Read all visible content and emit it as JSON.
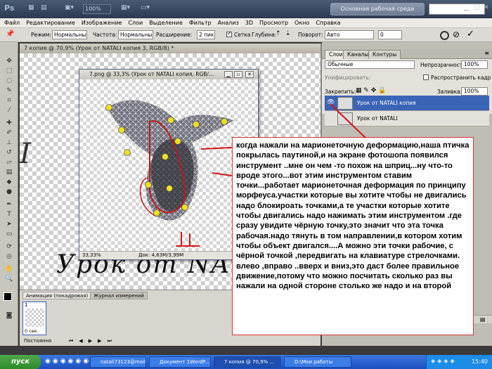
{
  "app": {
    "logo": "Ps",
    "zoom": "100%",
    "workspace": "Основная рабочая среда"
  },
  "menu": [
    "Файл",
    "Редактирование",
    "Изображение",
    "Слои",
    "Выделение",
    "Фильтр",
    "Анализ",
    "3D",
    "Просмотр",
    "Окно",
    "Справка"
  ],
  "options": {
    "mode_label": "Режим:",
    "mode_value": "Нормальный",
    "density_label": "Частота:",
    "density_value": "Нормальный",
    "expand_label": "Расширение:",
    "expand_value": "2 пикс",
    "mesh_label": "Сетка",
    "depth_label": "Глубина:",
    "rotate_label": "Поворот:",
    "rotate_value": "Авто",
    "angle_value": "0"
  },
  "document": {
    "title": "7 копия @ 70,9% (Урок от NATALI копия 3, RGB/8) *",
    "overlay_text": "Урок от NA",
    "partial_text": "I"
  },
  "inner_document": {
    "title": "7.png @ 33,3% (Урок от  NATALI копия, RGB/...",
    "zoom": "33,33%",
    "doc_info": "Док: 4,63М/3,99М"
  },
  "annotation": {
    "text": "когда нажали на марионеточную деформацию,наша птичка покрылась паутиной,и на  экране фотошопа появился инструмент ..мне он чем -то похож на шприц...ну что-то вроде этого...вот этим инструментом ставим точки...работает марионеточная деформация по принципу морфеуса.участки которые вы хотите чтобы не двигались надо блокироать точками,а те участки которые хотите чтобы двигались надо нажимать этим инструментом .где сразу увидите чёрную точку,это значит что эта точка рабочая.надо тянуть в том направлении,в котором хотим чтобы объект двигался....А можно  эти точки рабочие, с чёрной точкой ,передвигать на клавиатуре стрелочками. влево ,вправо ..вверх и вниз,это даст более правильное движение,потому что можно посчитать сколько раз вы нажали на одной стороне столько же надо и на второй"
  },
  "layers_panel": {
    "tabs": [
      "Слои",
      "Каналы",
      "Контуры"
    ],
    "blend_mode": "Обычные",
    "opacity_label": "Непрозрачность:",
    "opacity_value": "100%",
    "unify_label": "Унифицировать:",
    "propagate_label": "Распространить кадр 1",
    "lock_label": "Закрепить:",
    "fill_label": "Заливка:",
    "fill_value": "100%",
    "layers": [
      {
        "name": "Урок от  NATALI копия"
      },
      {
        "name": "Урок от  NATALI"
      }
    ]
  },
  "animation": {
    "tabs": [
      "Анимация (покадровая)",
      "Журнал измерений"
    ],
    "frame_number": "1",
    "frame_duration": "0 сек.",
    "loop": "Постоянно"
  },
  "taskbar": {
    "start": "пуск",
    "tasks": [
      "natali73123@mail.r...",
      "Документ 1WordP...",
      "7 копия @ 70,9% ...",
      "D:\\Мои работы"
    ],
    "clock": "15:40"
  }
}
